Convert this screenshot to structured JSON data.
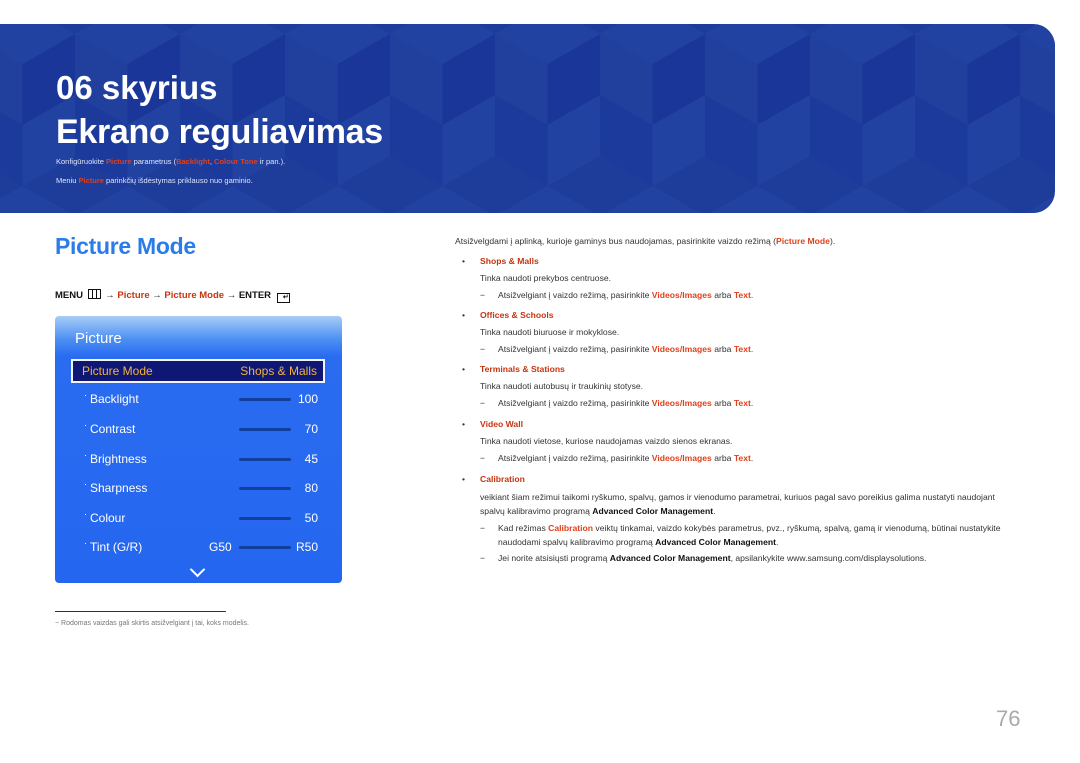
{
  "banner": {
    "chapter": "06 skyrius",
    "title": "Ekrano reguliavimas",
    "sub1": {
      "pre": "Konfigūruokite ",
      "hl1": "Picture",
      "mid": " parametrus (",
      "hl2": "Backlight",
      "sep": ", ",
      "hl3": "Colour Tone",
      "post": " ir pan.)."
    },
    "sub2": {
      "pre": "Meniu ",
      "hl1": "Picture",
      "post": " parinkčių išdėstymas priklauso nuo gaminio."
    }
  },
  "section": {
    "title": "Picture Mode",
    "menu_path": {
      "menu": "MENU",
      "arrow": "→",
      "p1": "Picture",
      "p2": "Picture Mode",
      "enter": "ENTER"
    }
  },
  "panel": {
    "title": "Picture",
    "selected": {
      "label": "Picture Mode",
      "value": "Shops & Malls"
    },
    "rows": [
      {
        "label": "Backlight",
        "value": "100"
      },
      {
        "label": "Contrast",
        "value": "70"
      },
      {
        "label": "Brightness",
        "value": "45"
      },
      {
        "label": "Sharpness",
        "value": "80"
      },
      {
        "label": "Colour",
        "value": "50"
      },
      {
        "label": "Tint (G/R)",
        "left": "G50",
        "value": "R50"
      }
    ],
    "more_icon": "chevron-down-icon"
  },
  "footnote": "Rodomas vaizdas gali skirtis atsižvelgiant į tai, koks modelis.",
  "right": {
    "intro": {
      "pre": "Atsižvelgdami į aplinką, kurioje gaminys bus naudojamas, pasirinkite vaizdo režimą (",
      "hl": "Picture Mode",
      "post": ")."
    },
    "note_common": {
      "pre": "Atsižvelgiant į vaizdo režimą, pasirinkite ",
      "hl1": "Videos/Images",
      "mid": " arba ",
      "hl2": "Text",
      "post": "."
    },
    "items": [
      {
        "name": "Shops & Malls",
        "desc": "Tinka naudoti prekybos centruose."
      },
      {
        "name": "Offices & Schools",
        "desc": "Tinka naudoti biuruose ir mokyklose."
      },
      {
        "name": "Terminals & Stations",
        "desc": "Tinka naudoti autobusų ir traukinių stotyse."
      },
      {
        "name": "Video Wall",
        "desc": "Tinka naudoti vietose, kuriose naudojamas vaizdo sienos ekranas."
      }
    ],
    "calibration": {
      "name": "Calibration",
      "desc_pre": "veikiant šiam režimui taikomi ryškumo, spalvų, gamos ir vienodumo parametrai, kuriuos pagal savo poreikius galima nustatyti naudojant spalvų kalibravimo programą ",
      "desc_bold": "Advanced Color Management",
      "desc_post": ".",
      "note1_pre": "Kad režimas ",
      "note1_hl": "Calibration",
      "note1_mid": " veiktų tinkamai, vaizdo kokybės parametrus, pvz., ryškumą, spalvą, gamą ir vienodumą, būtinai nustatykite naudodami spalvų kalibravimo programą ",
      "note1_bold": "Advanced Color Management",
      "note1_post": ".",
      "note2_pre": "Jei norite atsisiųsti programą ",
      "note2_bold": "Advanced Color Management",
      "note2_post": ", apsilankykite www.samsung.com/displaysolutions."
    }
  },
  "page_number": "76"
}
